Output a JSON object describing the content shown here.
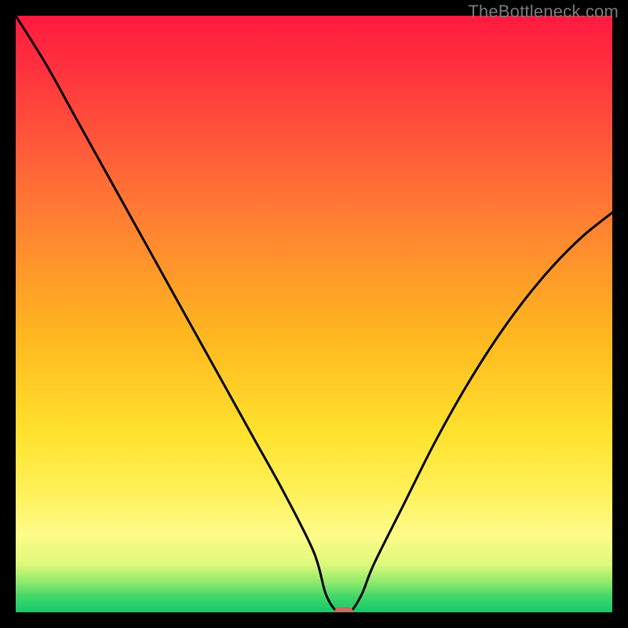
{
  "watermark": "TheBottleneck.com",
  "chart_data": {
    "type": "line",
    "title": "",
    "xlabel": "",
    "ylabel": "",
    "xlim": [
      0,
      100
    ],
    "ylim": [
      0,
      100
    ],
    "series": [
      {
        "name": "bottleneck-curve",
        "x": [
          0,
          5,
          10,
          15,
          20,
          25,
          30,
          35,
          40,
          45,
          50,
          52,
          54,
          56,
          58,
          60,
          65,
          70,
          75,
          80,
          85,
          90,
          95,
          100
        ],
        "values": [
          100,
          92,
          83,
          74,
          65,
          56,
          47,
          38,
          29,
          20,
          10,
          3,
          0,
          0,
          3,
          8,
          18,
          28,
          37,
          45,
          52,
          58,
          63,
          67
        ]
      }
    ],
    "marker": {
      "x": 55,
      "y": 0
    },
    "colors": {
      "curve": "#000000",
      "marker": "#cb6b62",
      "gradient_top": "#ff1a3f",
      "gradient_mid": "#ffe22e",
      "gradient_bottom": "#12c96a",
      "frame": "#000000"
    }
  }
}
